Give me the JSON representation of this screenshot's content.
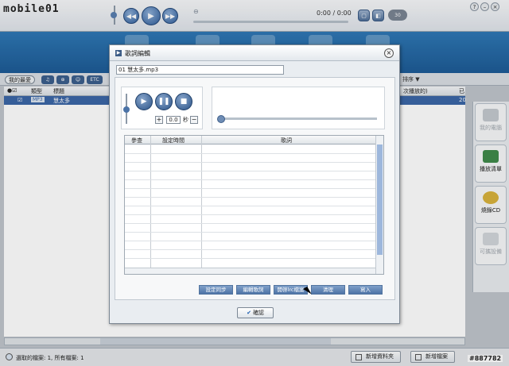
{
  "app": {
    "logo_text": "mobile01",
    "time_text": "0:00 / 0:00",
    "top_pill": "30",
    "tabs": {
      "mine": "我的最愛"
    },
    "mini_tabs": [
      "♫",
      "⊕",
      "☺",
      "ETC"
    ],
    "sort_label": "排序 ▼"
  },
  "list": {
    "headers": [
      "類型",
      "標題",
      "次播放的)",
      "已"
    ],
    "rows": [
      {
        "type": "MP3",
        "title": "慧太多",
        "right": "20"
      }
    ]
  },
  "sidebar": {
    "items": [
      {
        "label": "我的電腦",
        "dim": true
      },
      {
        "label": "播放清單",
        "dim": false
      },
      {
        "label": "燒錄CD",
        "dim": false
      },
      {
        "label": "可攜設備",
        "dim": true
      }
    ]
  },
  "statusbar": {
    "text": "選取的檔案: 1, 所有檔案: 1",
    "add_folder": "新增資料夾",
    "add_file": "新增檔案",
    "watermark": "#887782"
  },
  "dialog": {
    "title": "歌詞編輯",
    "file_name": "01 慧太多.mp3",
    "seconds_value": "0.0",
    "seconds_unit": "秒",
    "table_headers": [
      "參查",
      "設定時間",
      "歌詞"
    ],
    "buttons": [
      "設定同步",
      "編輯歌詞",
      "開啓lrc檔案",
      "清理",
      "寫入"
    ],
    "ok_label": "確認"
  },
  "colors": {
    "accent": "#2f78b5",
    "selection": "#3b66a6"
  }
}
